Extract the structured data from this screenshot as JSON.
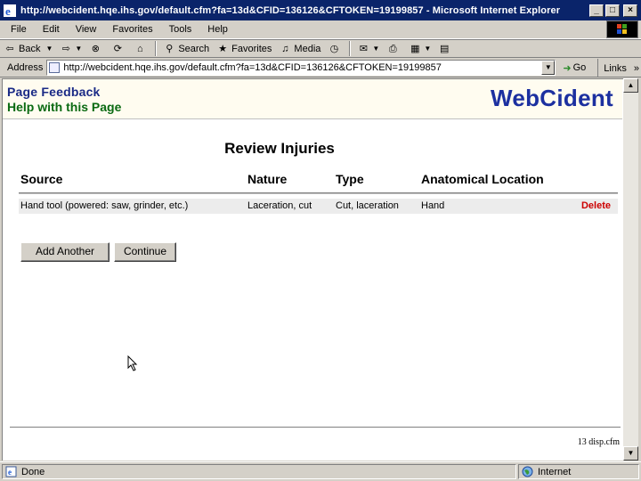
{
  "window": {
    "title": "http://webcident.hqe.ihs.gov/default.cfm?fa=13d&CFID=136126&CFTOKEN=19199857 - Microsoft Internet Explorer",
    "min_glyph": "_",
    "max_glyph": "□",
    "close_glyph": "×"
  },
  "menu": {
    "items": [
      "File",
      "Edit",
      "View",
      "Favorites",
      "Tools",
      "Help"
    ]
  },
  "toolbar": {
    "back": "Back",
    "search": "Search",
    "favorites": "Favorites",
    "media": "Media"
  },
  "address": {
    "label": "Address",
    "url": "http://webcident.hqe.ihs.gov/default.cfm?fa=13d&CFID=136126&CFTOKEN=19199857",
    "go": "Go",
    "links": "Links",
    "links_more": "»"
  },
  "page": {
    "feedback_link": "Page Feedback",
    "help_link": "Help with this Page",
    "brand": "WebCident",
    "title": "Review Injuries",
    "columns": {
      "source": "Source",
      "nature": "Nature",
      "type": "Type",
      "location": "Anatomical Location"
    },
    "row": {
      "source": "Hand tool (powered: saw, grinder, etc.)",
      "nature": "Laceration, cut",
      "type": "Cut, laceration",
      "location": "Hand",
      "delete": "Delete"
    },
    "add_button": "Add Another",
    "continue_button": "Continue",
    "footer": "13 disp.cfm"
  },
  "status": {
    "text": "Done",
    "zone": "Internet"
  },
  "colors": {
    "title_bar": "#0a246a",
    "brand": "#1c30a0",
    "help_link": "#0a6a12",
    "delete_link": "#cc0000"
  }
}
